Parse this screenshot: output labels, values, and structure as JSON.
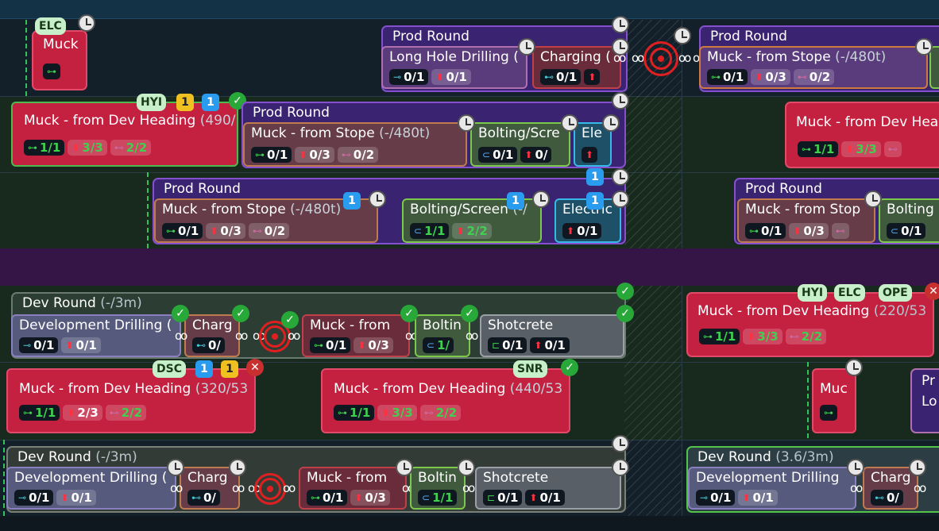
{
  "title": {
    "prod": "Prod Round",
    "dev": "Dev Round",
    "dev_range": "(-/3m)",
    "dev_range2": "(3.6/3m)"
  },
  "tasks": {
    "muck": "Muck",
    "muck_stope": "Muck - from Stope",
    "muck_stope_range": "(-/480t)",
    "muck_stope_short": "Muck - from Stop",
    "muck_from": "Muck - from",
    "muc": "Muc",
    "muck_dev": "Muck - from Dev Heading",
    "muck_dev_range_490": "(490/",
    "muck_dev_hea": "Muck - from Dev Hea",
    "muck_dev_range_220": "(220/53",
    "muck_dev_range_320": "(320/53",
    "muck_dev_range_440": "(440/53",
    "lhd": "Long Hole Drilling (",
    "charging": "Charging (",
    "charg": "Charg",
    "bolting_scre": "Bolting/Scre",
    "bolting_screen": "Bolting/Screen",
    "bolting_screen_range": "(-/",
    "bolting": "Bolting",
    "boltin": "Boltin",
    "ele": "Ele",
    "electric": "Electric",
    "dev_drilling": "Development Drilling",
    "dev_drilling_paren": "Development Drilling (",
    "shotcrete": "Shotcrete",
    "pr": "Pr",
    "lo": "Lo"
  },
  "values": {
    "v01": "0/1",
    "v11": "1/1",
    "v03": "0/3",
    "v33": "3/3",
    "v23": "2/3",
    "v02": "0/2",
    "v22": "2/2",
    "v0": "0/",
    "v1": "1/"
  },
  "tags": {
    "elc": "ELC",
    "hyi": "HYI",
    "ope": "OPE",
    "dsc": "DSC",
    "snr": "SNR"
  },
  "badges": {
    "one": "1"
  },
  "icons": {
    "loader": "loader-icon",
    "drill": "drill-icon",
    "arrow": "arrow-up-icon",
    "truck": "truck-icon",
    "bolt": "bolter-icon",
    "shot": "shotcrete-icon",
    "charge": "charger-icon",
    "clock": "clock-icon",
    "check": "check-icon",
    "x": "x-icon",
    "target": "target-icon",
    "link": "link-icon"
  },
  "glyphs": {
    "loader": "⊶",
    "drill": "⊸",
    "arrow": "⬆",
    "truck": "⊷",
    "bolt": "⊂",
    "shot": "⊏",
    "charge": "⊷",
    "check": "✓",
    "x": "✕",
    "link": "oo"
  },
  "colors": {
    "prod": "#3a2370",
    "dev": "#2c3d34",
    "red": "#c4203f",
    "green": "#3fd050",
    "lane_purple": "#351546"
  }
}
